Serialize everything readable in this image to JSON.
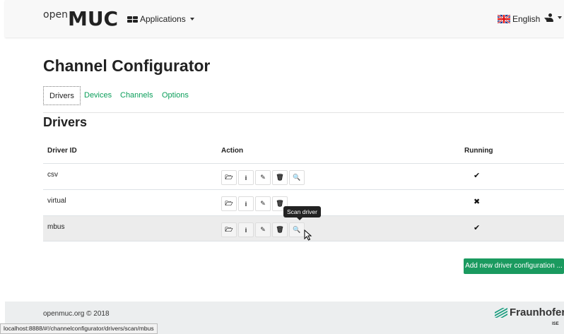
{
  "navbar": {
    "logo_small": "open",
    "logo_large": "MUC",
    "applications_label": "Applications",
    "language_label": "English"
  },
  "page": {
    "title": "Channel Configurator",
    "section_title": "Drivers"
  },
  "tabs": [
    {
      "label": "Drivers",
      "active": true
    },
    {
      "label": "Devices",
      "active": false
    },
    {
      "label": "Channels",
      "active": false
    },
    {
      "label": "Options",
      "active": false
    }
  ],
  "table": {
    "headers": {
      "id": "Driver ID",
      "action": "Action",
      "running": "Running"
    },
    "rows": [
      {
        "id": "csv",
        "running": "✔"
      },
      {
        "id": "virtual",
        "running": "✖"
      },
      {
        "id": "mbus",
        "running": "✔"
      }
    ],
    "action_icons": [
      "folder-icon",
      "info-icon",
      "pencil-icon",
      "trash-icon",
      "search-icon"
    ],
    "action_glyphs": {
      "info": "i"
    }
  },
  "tooltip": "Scan driver",
  "add_button": "Add new driver configuration ...",
  "footer": {
    "copyright": "openmuc.org © 2018",
    "brand": "Fraunhofer",
    "brand_sub": "ISE"
  },
  "status_url": "localhost:8888/#!/channelconfigurator/drivers/scan/mbus",
  "colors": {
    "accent": "#1a9a5f",
    "link": "#0a9e5a",
    "navbar_bg": "#f8f8f8",
    "footer_bg": "#eceeef"
  }
}
